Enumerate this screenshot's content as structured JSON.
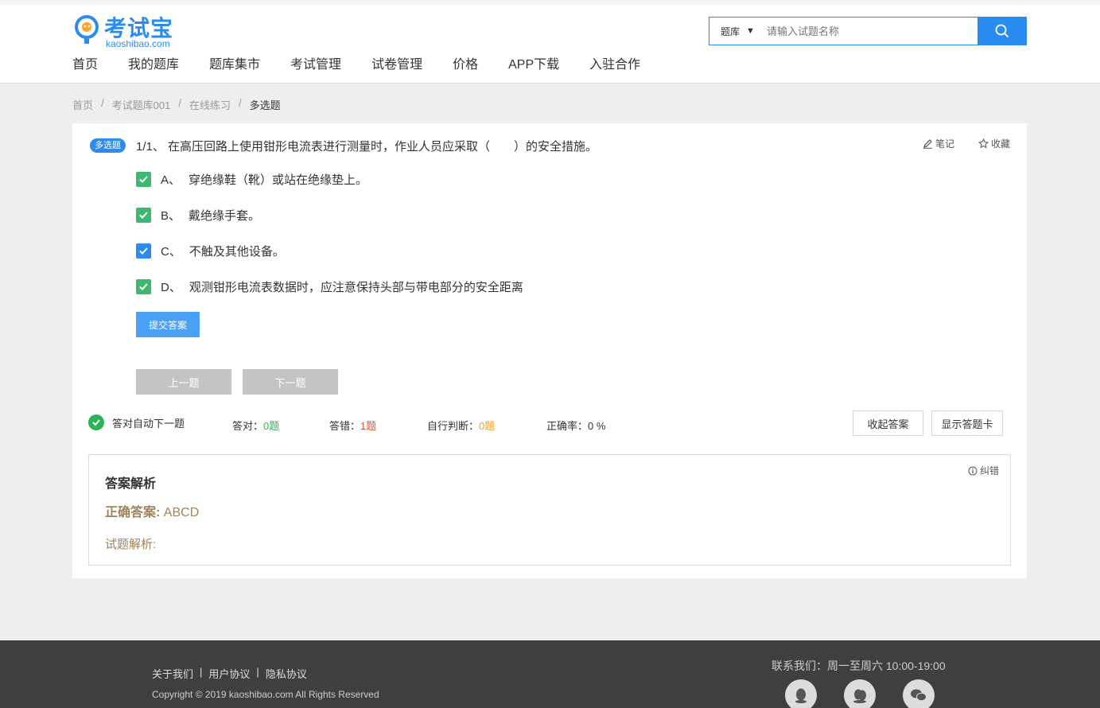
{
  "site": {
    "logo_zh": "考试宝",
    "logo_en": "kaoshibao.com"
  },
  "nav": [
    "首页",
    "我的题库",
    "题库集市",
    "考试管理",
    "试卷管理",
    "价格",
    "APP下载",
    "入驻合作"
  ],
  "search": {
    "category": "题库",
    "placeholder": "请输入试题名称"
  },
  "breadcrumb": [
    "首页",
    "/",
    "考试题库001",
    "/",
    "在线练习",
    "/",
    "多选题"
  ],
  "question": {
    "tag": "多选题",
    "text": "1/1、 在高压回路上使用钳形电流表进行测量时，作业人员应采取（　　）的安全措施。",
    "note_label": "笔记",
    "fav_label": "收藏",
    "options": [
      {
        "key": "A、",
        "text": "穿绝缘鞋（靴）或站在绝缘垫上。",
        "state": "checked-green"
      },
      {
        "key": "B、",
        "text": "戴绝缘手套。",
        "state": "checked-green"
      },
      {
        "key": "C、",
        "text": "不触及其他设备。",
        "state": "checked-blue"
      },
      {
        "key": "D、",
        "text": "观测钳形电流表数据时，应注意保持头部与带电部分的安全距离",
        "state": "checked-green"
      }
    ],
    "submit_label": "提交答案",
    "prev_label": "上一题",
    "next_label": "下一题"
  },
  "stats": {
    "auto_next_label": "答对自动下一题",
    "correct_label": "答对：",
    "correct_value": "0题",
    "wrong_label": "答错：",
    "wrong_value": "1题",
    "self_label": "自行判断：",
    "self_value": "0题",
    "rate_label": "正确率：",
    "rate_value": "0 %",
    "collapse_label": "收起答案",
    "card_label": "显示答题卡"
  },
  "analysis": {
    "title": "答案解析",
    "answer_label": "正确答案:",
    "answer_value": "ABCD",
    "explain_label": "试题解析:",
    "error_label": "纠错"
  },
  "footer": {
    "links": [
      "关于我们",
      "|",
      "用户协议",
      "|",
      "隐私协议"
    ],
    "copyright": "Copyright © 2019 kaoshibao.com All Rights Reserved",
    "contact": "联系我们：周一至周六 10:00-19:00"
  },
  "colors": {
    "accent": "#2a8cf0",
    "green": "#3cb870",
    "wrong": "#e4502b",
    "self": "#f0a020",
    "answer": "#a0835a"
  }
}
